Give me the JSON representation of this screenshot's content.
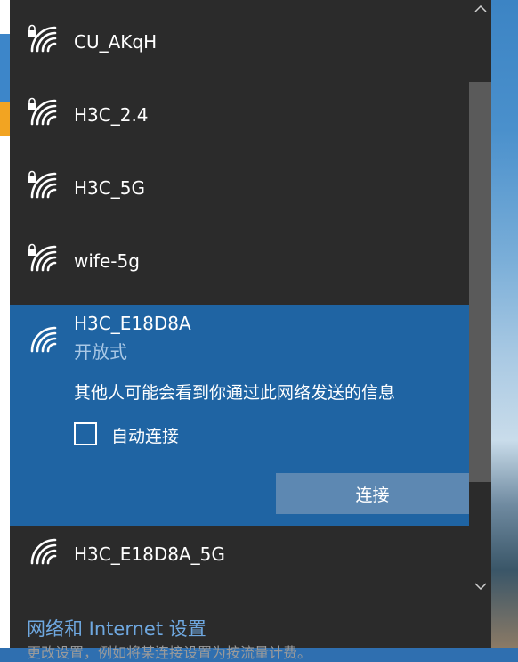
{
  "networks": [
    {
      "name": "CU_AKqH",
      "secured": true
    },
    {
      "name": "H3C_2.4",
      "secured": true
    },
    {
      "name": "H3C_5G",
      "secured": true
    },
    {
      "name": "wife-5g",
      "secured": true
    },
    {
      "name": "H3C_E18D8A",
      "secured": false,
      "security": "开放式",
      "info": "其他人可能会看到你通过此网络发送的信息",
      "auto_connect_label": "自动连接",
      "auto_connect": false,
      "connect_label": "连接"
    },
    {
      "name": "H3C_E18D8A_5G",
      "secured": false
    }
  ],
  "footer": {
    "settings_link": "网络和 Internet 设置",
    "hint": "更改设置，例如将某连接设置为按流量计费。"
  },
  "colors": {
    "panel_bg": "#2b2b2b",
    "selected_bg": "#1f64a3",
    "button_bg": "#5d88b2",
    "link": "#6fa8e0",
    "security_text": "#a9c8e6"
  },
  "icons": {
    "wifi": "wifi-signal-icon",
    "lock": "lock-icon",
    "scroll_up": "chevron-up-icon",
    "scroll_down": "chevron-down-icon"
  }
}
